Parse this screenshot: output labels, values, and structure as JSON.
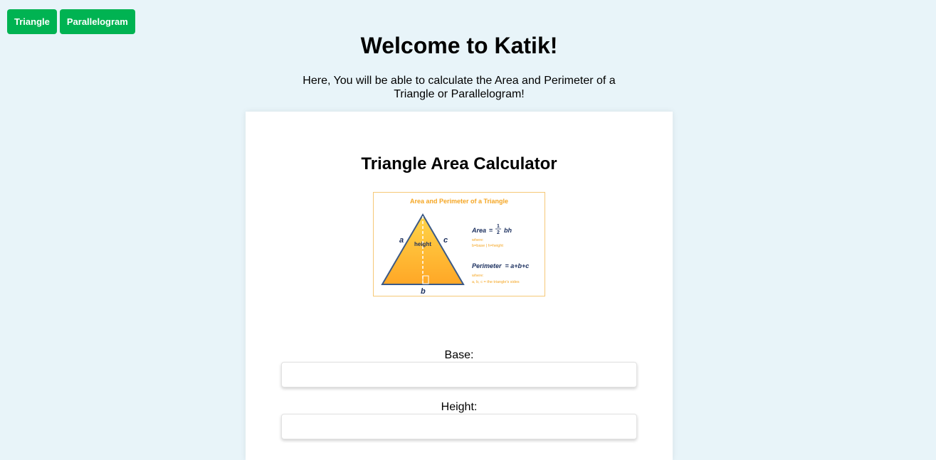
{
  "nav": {
    "buttons": [
      "Triangle",
      "Parallelogram"
    ]
  },
  "header": {
    "title": "Welcome to Katik!",
    "intro": "Here, You will be able to calculate the Area and Perimeter of a Triangle or Parallelogram!"
  },
  "calculator": {
    "title": "Triangle Area Calculator",
    "diagram": {
      "title": "Area and Perimeter of a Triangle",
      "side_a": "a",
      "side_b": "b",
      "side_c": "c",
      "height_label": "height",
      "area_label": "Area",
      "area_formula_rest": "bh",
      "area_fraction_num": "1",
      "area_fraction_den": "2",
      "area_where": "where:",
      "area_where_text": "b=base | h=height",
      "perimeter_formula": "Perimeter  = a+b+c",
      "perimeter_where": "where:",
      "perimeter_where_text": "a, b, c = the triangle's sides",
      "colors": {
        "fill_top": "#ffd54a",
        "fill_bottom": "#ffa726",
        "outline": "#3c5a86",
        "navy": "#1b2f5e",
        "orange": "#f5a623"
      }
    },
    "fields": {
      "base_label": "Base:",
      "base_value": "",
      "height_label": "Height:",
      "height_value": ""
    }
  },
  "colors": {
    "page_bg": "#e8f4f9",
    "button_bg": "#00b352",
    "button_text": "#ffffff",
    "card_bg": "#ffffff"
  }
}
